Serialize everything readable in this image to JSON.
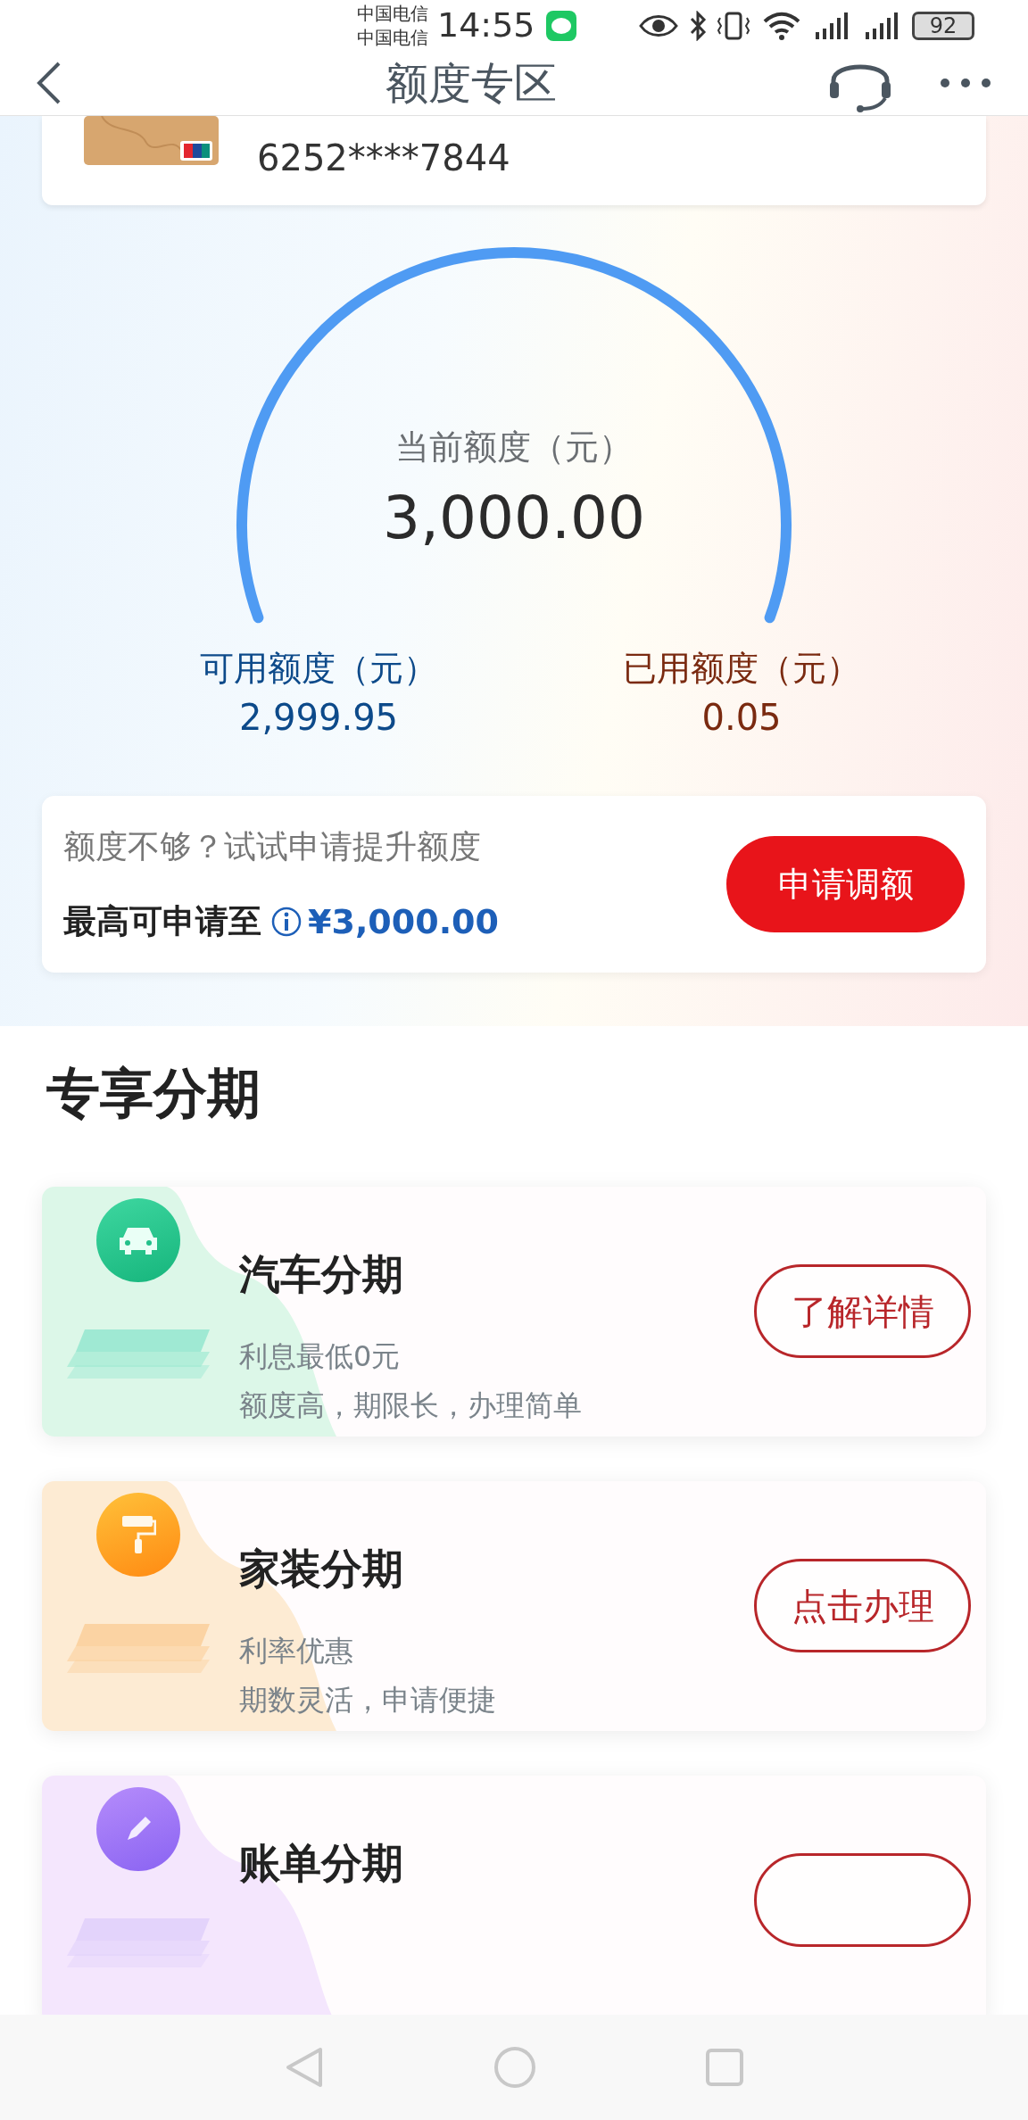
{
  "status_bar": {
    "carriers": [
      "中国电信",
      "中国电信"
    ],
    "time": "14:55",
    "battery": "92"
  },
  "header": {
    "title": "额度专区"
  },
  "card": {
    "number": "6252****7844"
  },
  "gauge": {
    "label": "当前额度（元）",
    "value": "3,000.00"
  },
  "stats": [
    {
      "label": "可用额度（元）",
      "value": "2,999.95",
      "color": "#0d4a8a"
    },
    {
      "label": "已用额度（元）",
      "value": "0.05",
      "color": "#7a2a10"
    }
  ],
  "promo": {
    "hint": "额度不够？试试申请提升额度",
    "max_label": "最高可申请至",
    "max_value": "¥3,000.00",
    "button": "申请调额"
  },
  "section_title": "专享分期",
  "products": [
    {
      "kind": "car",
      "title": "汽车分期",
      "lines": [
        "利息最低0元",
        "额度高，期限长，办理简单"
      ],
      "button": "了解详情"
    },
    {
      "kind": "home",
      "title": "家装分期",
      "lines": [
        "利率优惠",
        "期数灵活，申请便捷"
      ],
      "button": "点击办理"
    },
    {
      "kind": "bill",
      "title": "账单分期"
    }
  ]
}
